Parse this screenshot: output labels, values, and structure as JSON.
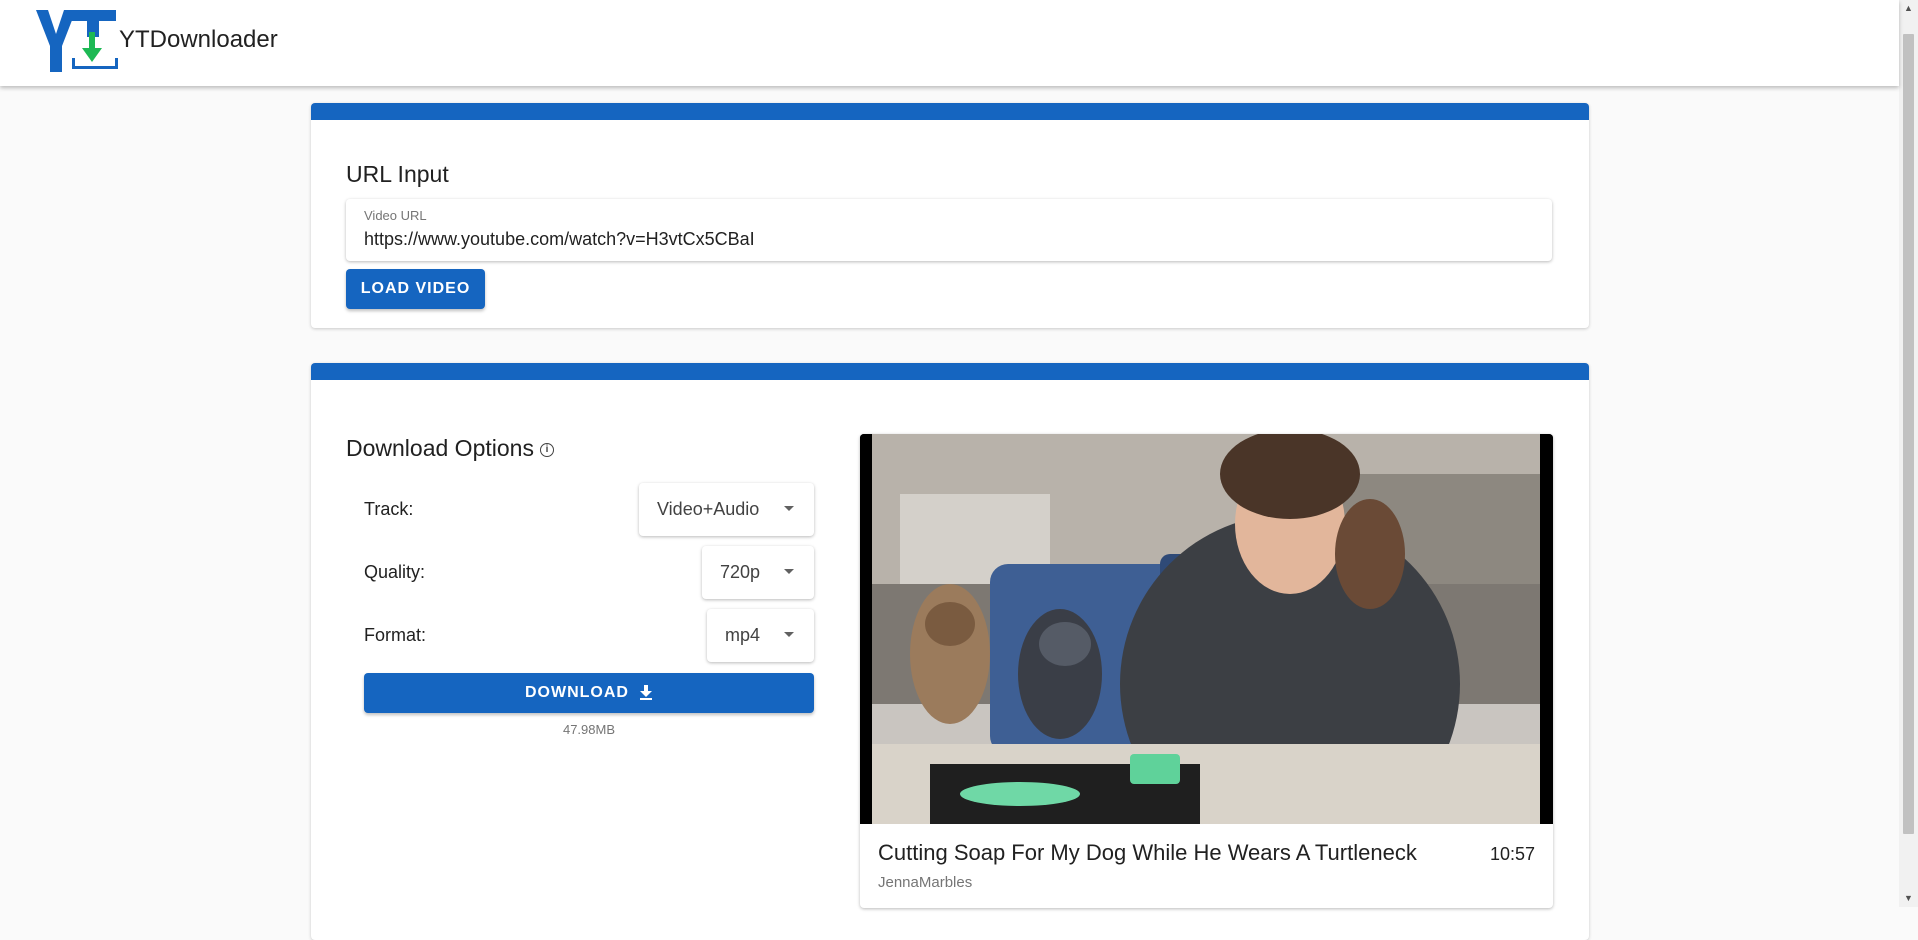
{
  "app": {
    "title": "YTDownloader"
  },
  "url_input": {
    "heading": "URL Input",
    "field_label": "Video URL",
    "field_value": "https://www.youtube.com/watch?v=H3vtCx5CBaI",
    "load_button": "LOAD VIDEO"
  },
  "download_options": {
    "heading": "Download Options",
    "track": {
      "label": "Track:",
      "value": "Video+Audio"
    },
    "quality": {
      "label": "Quality:",
      "value": "720p"
    },
    "format": {
      "label": "Format:",
      "value": "mp4"
    },
    "download_button": "DOWNLOAD",
    "file_size": "47.98MB"
  },
  "video": {
    "title": "Cutting Soap For My Dog While He Wears A Turtleneck",
    "duration": "10:57",
    "channel": "JennaMarbles"
  },
  "colors": {
    "primary": "#1565c0",
    "logo_blue": "#1565c0",
    "logo_green": "#1db954"
  },
  "icons": [
    "logo-icon",
    "info-icon",
    "chevron-down-icon",
    "download-icon"
  ]
}
